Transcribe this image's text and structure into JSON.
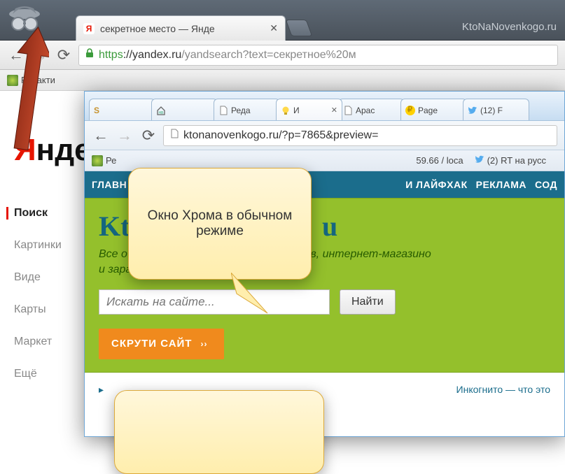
{
  "watermark": "KtoNaNovenkogo.ru",
  "outer": {
    "tab_title": "секретное место — Янде",
    "url_https": "https",
    "url_host": "://yandex.ru",
    "url_path": "/yandsearch?text=секретное%20м",
    "bookmarks": {
      "item0": "Редакти"
    }
  },
  "yandex": {
    "logo_y": "Я",
    "logo_rest": "нде",
    "nav": {
      "search": "Поиск",
      "images": "Картинки",
      "video": "Виде",
      "maps": "Карты",
      "market": "Маркет",
      "more": "Ещё"
    }
  },
  "inner": {
    "tabs": {
      "t0": "",
      "t1": "",
      "t2": "Реда",
      "t3": "И",
      "t4": "Apac",
      "t5": "Page",
      "t6": "(12) F"
    },
    "url": "ktonanovenkogo.ru/?p=7865&preview=",
    "bookmarks": {
      "b0": "Ре",
      "b1": "59.66 / loca",
      "b2": "(2) RT на русс"
    }
  },
  "site": {
    "nav": {
      "n0": "ГЛАВН",
      "n1": "И ЛАЙФХАК",
      "n2": "РЕКЛАМА",
      "n3": "СОД"
    },
    "title_left": "Kt",
    "title_right": "u",
    "tagline1": "Все о со",
    "tagline2": "орумов, интернет-магазино",
    "tagline3": "и заработке на сайте",
    "search_placeholder": "Искать на сайте...",
    "search_btn": "Найти",
    "promo": "СКРУТИ САЙТ",
    "footer_right": "Инкогнито — что это"
  },
  "callout": {
    "text": "Окно Хрома в обычном режиме"
  }
}
